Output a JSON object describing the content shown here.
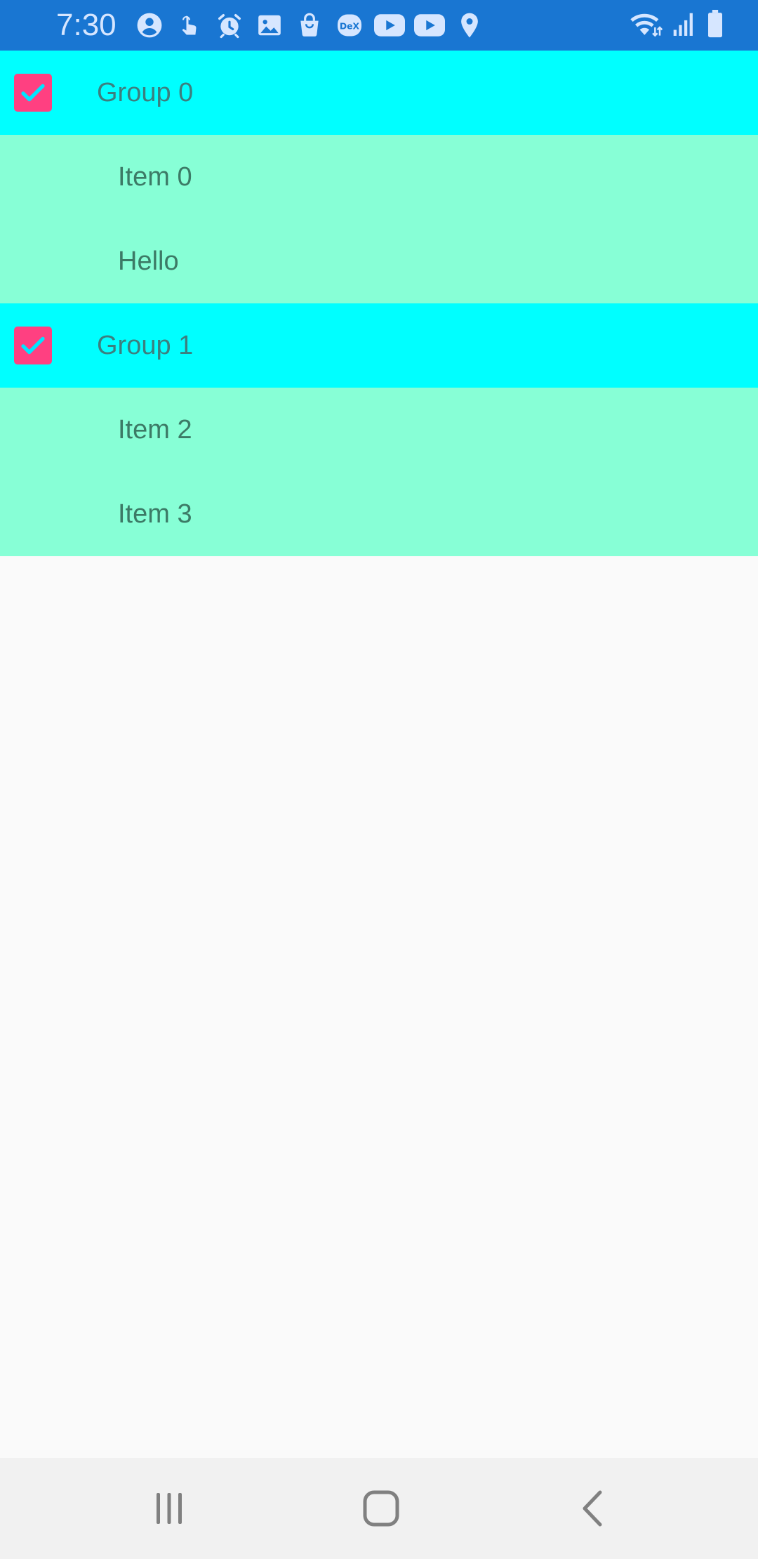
{
  "status_bar": {
    "time": "7:30",
    "left_icons": [
      "account-circle-icon",
      "touch-hand-icon",
      "alarm-icon",
      "gallery-image-icon",
      "shopping-bag-icon",
      "dex-icon",
      "youtube-icon",
      "youtube-icon",
      "location-pin-icon"
    ],
    "dex_text": "DeX",
    "right_icons": [
      "wifi-icon",
      "signal-icon",
      "battery-icon"
    ],
    "color": "#1976d2"
  },
  "list": {
    "groups": [
      {
        "label": "Group 0",
        "checked": true,
        "children": [
          {
            "label": "Item 0"
          },
          {
            "label": "Hello"
          }
        ]
      },
      {
        "label": "Group 1",
        "checked": true,
        "children": [
          {
            "label": "Item 2"
          },
          {
            "label": "Item 3"
          }
        ]
      }
    ],
    "group_color": "#00ffff",
    "child_color": "#87ffd6",
    "checkbox_color": "#ff4081"
  },
  "nav_bar": {
    "buttons": [
      "recents-icon",
      "home-icon",
      "back-icon"
    ]
  }
}
